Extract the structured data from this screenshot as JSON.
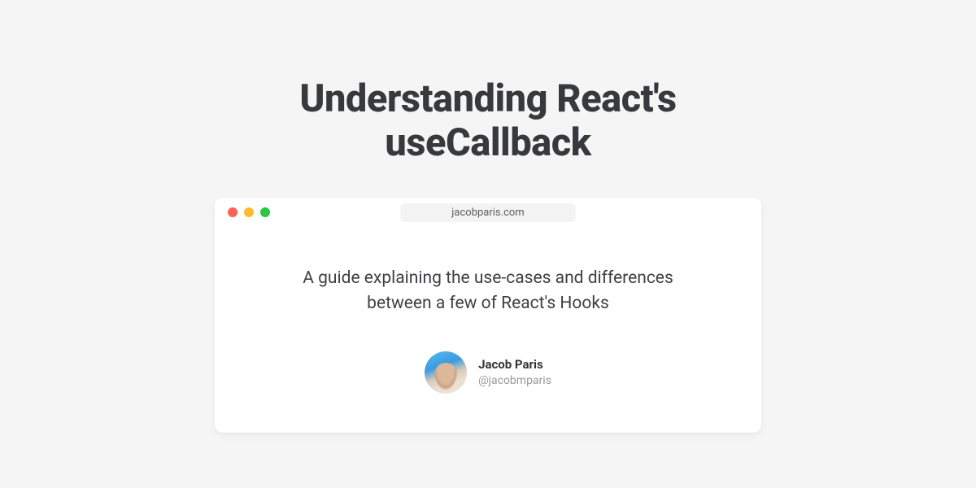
{
  "title": "Understanding React's useCallback",
  "browser": {
    "url": "jacobparis.com",
    "description": "A guide explaining the use-cases and differences between a few of React's Hooks"
  },
  "author": {
    "name": "Jacob Paris",
    "handle": "@jacobmparis"
  }
}
